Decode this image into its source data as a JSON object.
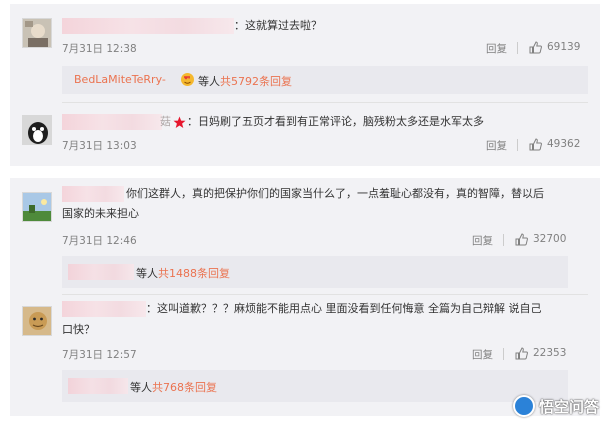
{
  "comments_top": [
    {
      "text": "：这就算过去啦？",
      "date": "7月31日 12:38",
      "reply_label": "回复",
      "likes": "69139",
      "sub": {
        "users": "BedLaMiteTeRry-",
        "badge_icon": "heart-face-emoji",
        "mid": "等人",
        "link": "共5792条回复"
      }
    },
    {
      "name_suffix": "菇",
      "star_icon": "red-star-icon",
      "text": "：日妈刷了五页才看到有正常评论，脑残粉太多还是水军太多",
      "date": "7月31日 13:03",
      "reply_label": "回复",
      "likes": "49362"
    }
  ],
  "comments_bottom": [
    {
      "text_line1": "你们这群人，真的把保护你们的国家当什么了，一点羞耻心都没有，真的智障，替以后",
      "text_line2": "国家的未来担心",
      "date": "7月31日 12:46",
      "reply_label": "回复",
      "likes": "32700",
      "sub": {
        "mid": "等人",
        "link": "共1488条回复"
      }
    },
    {
      "text_line1": "：这叫道歉？？？麻烦能不能用点心 里面没看到任何悔意 全篇为自己辩解 说自己",
      "text_line2": "口快？",
      "date": "7月31日 12:57",
      "reply_label": "回复",
      "likes": "22353",
      "sub": {
        "mid": "等人",
        "link": "共768条回复"
      }
    }
  ],
  "watermark": {
    "text": "悟空问答",
    "logo_icon": "wukong-logo-icon"
  },
  "colors": {
    "panel": "#f2f2f5",
    "link": "#eb7350",
    "meta": "#808080"
  }
}
